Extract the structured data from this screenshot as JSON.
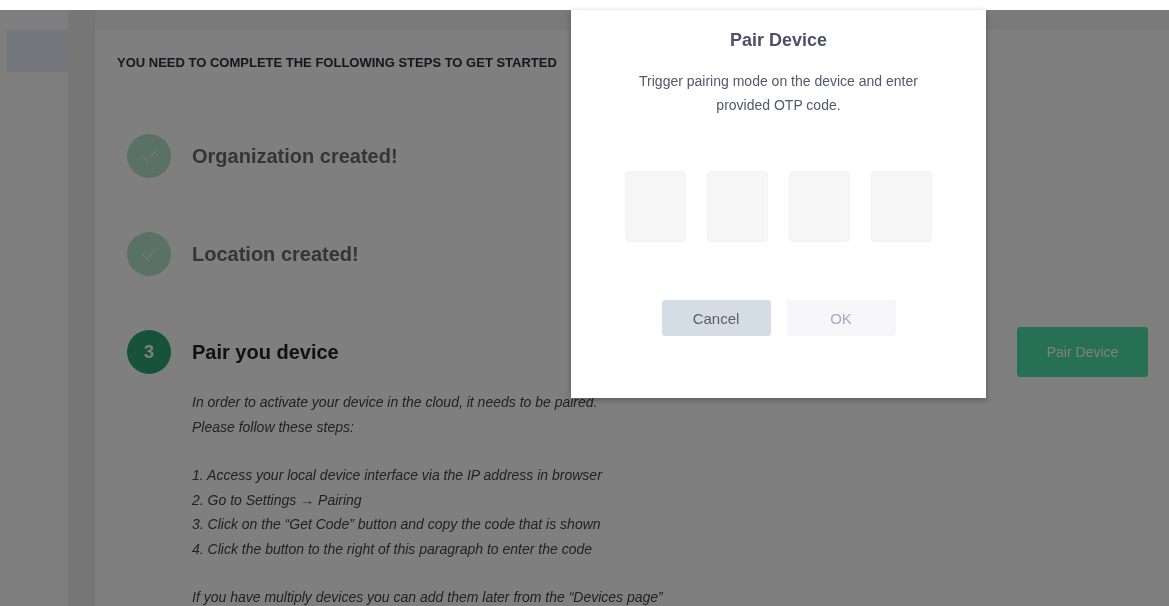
{
  "heading": "YOU NEED TO COMPLETE THE FOLLOWING STEPS TO GET STARTED",
  "steps": [
    {
      "title": "Organization created!",
      "completed": true
    },
    {
      "title": "Location created!",
      "completed": true
    },
    {
      "title": "Pair you device",
      "completed": false,
      "number": "3",
      "action": "Pair Device",
      "intro": [
        "In order to activate your device in the cloud, it needs to be paired.",
        "Please follow these steps:"
      ],
      "instructions": [
        "1. Access your local device interface via the IP address in browser",
        "2. Go to Settings → Pairing",
        "3. Click on the “Get Code” button and copy the code that is shown",
        "4. Click the button to the right of this paragraph to enter the code"
      ],
      "note": "If you have multiply devices you can add them later from the “Devices page”"
    }
  ],
  "modal": {
    "title": "Pair Device",
    "text": "Trigger pairing mode on the device and enter provided OTP code.",
    "buttons": [
      {
        "label": "Cancel",
        "disabled": false
      },
      {
        "label": "OK",
        "disabled": true
      }
    ]
  }
}
